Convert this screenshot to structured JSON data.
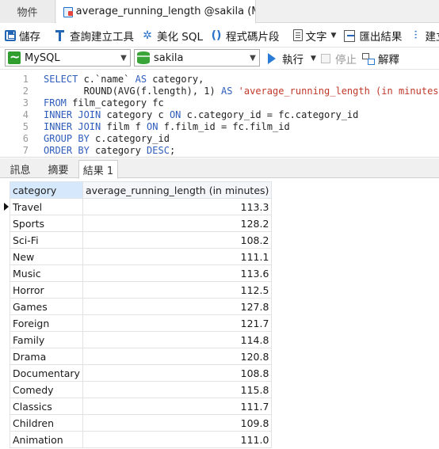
{
  "tabs": {
    "objects": "物件",
    "query": "average_running_length @sakila (MySQ..."
  },
  "toolbar": {
    "save": "儲存",
    "query_builder": "查詢建立工具",
    "beautify": "美化 SQL",
    "snippet": "程式碼片段",
    "text": "文字",
    "export": "匯出結果",
    "build": "建立"
  },
  "connection": {
    "connection_value": "MySQL",
    "database_value": "sakila",
    "run": "執行",
    "stop": "停止",
    "explain": "解釋"
  },
  "editor": {
    "lines": [
      {
        "n": "1",
        "parts": [
          [
            "kw",
            "SELECT"
          ],
          [
            "t",
            " c.`name` "
          ],
          [
            "kw",
            "AS"
          ],
          [
            "t",
            " category,"
          ]
        ]
      },
      {
        "n": "2",
        "parts": [
          [
            "t",
            "       ROUND(AVG(f.length), 1) "
          ],
          [
            "kw",
            "AS"
          ],
          [
            "t",
            " "
          ],
          [
            "str",
            "'average_running_length (in minutes)'"
          ]
        ]
      },
      {
        "n": "3",
        "parts": [
          [
            "kw",
            "FROM"
          ],
          [
            "t",
            " film_category fc"
          ]
        ]
      },
      {
        "n": "4",
        "parts": [
          [
            "kw",
            "INNER JOIN"
          ],
          [
            "t",
            " category c "
          ],
          [
            "kw",
            "ON"
          ],
          [
            "t",
            " c.category_id = fc.category_id"
          ]
        ]
      },
      {
        "n": "5",
        "parts": [
          [
            "kw",
            "INNER JOIN"
          ],
          [
            "t",
            " film f "
          ],
          [
            "kw",
            "ON"
          ],
          [
            "t",
            " f.film_id = fc.film_id"
          ]
        ]
      },
      {
        "n": "6",
        "parts": [
          [
            "kw",
            "GROUP BY"
          ],
          [
            "t",
            " c.category_id"
          ]
        ]
      },
      {
        "n": "7",
        "parts": [
          [
            "kw",
            "ORDER BY"
          ],
          [
            "t",
            " category "
          ],
          [
            "kw",
            "DESC"
          ],
          [
            "t",
            ";"
          ]
        ]
      }
    ]
  },
  "result_tabs": {
    "info": "訊息",
    "summary": "摘要",
    "result": "結果 1"
  },
  "grid": {
    "columns": [
      "category",
      "average_running_length (in minutes)"
    ],
    "rows": [
      [
        "Travel",
        "113.3"
      ],
      [
        "Sports",
        "128.2"
      ],
      [
        "Sci-Fi",
        "108.2"
      ],
      [
        "New",
        "111.1"
      ],
      [
        "Music",
        "113.6"
      ],
      [
        "Horror",
        "112.5"
      ],
      [
        "Games",
        "127.8"
      ],
      [
        "Foreign",
        "121.7"
      ],
      [
        "Family",
        "114.8"
      ],
      [
        "Drama",
        "120.8"
      ],
      [
        "Documentary",
        "108.8"
      ],
      [
        "Comedy",
        "115.8"
      ],
      [
        "Classics",
        "111.7"
      ],
      [
        "Children",
        "109.8"
      ],
      [
        "Animation",
        "111.0"
      ]
    ]
  }
}
